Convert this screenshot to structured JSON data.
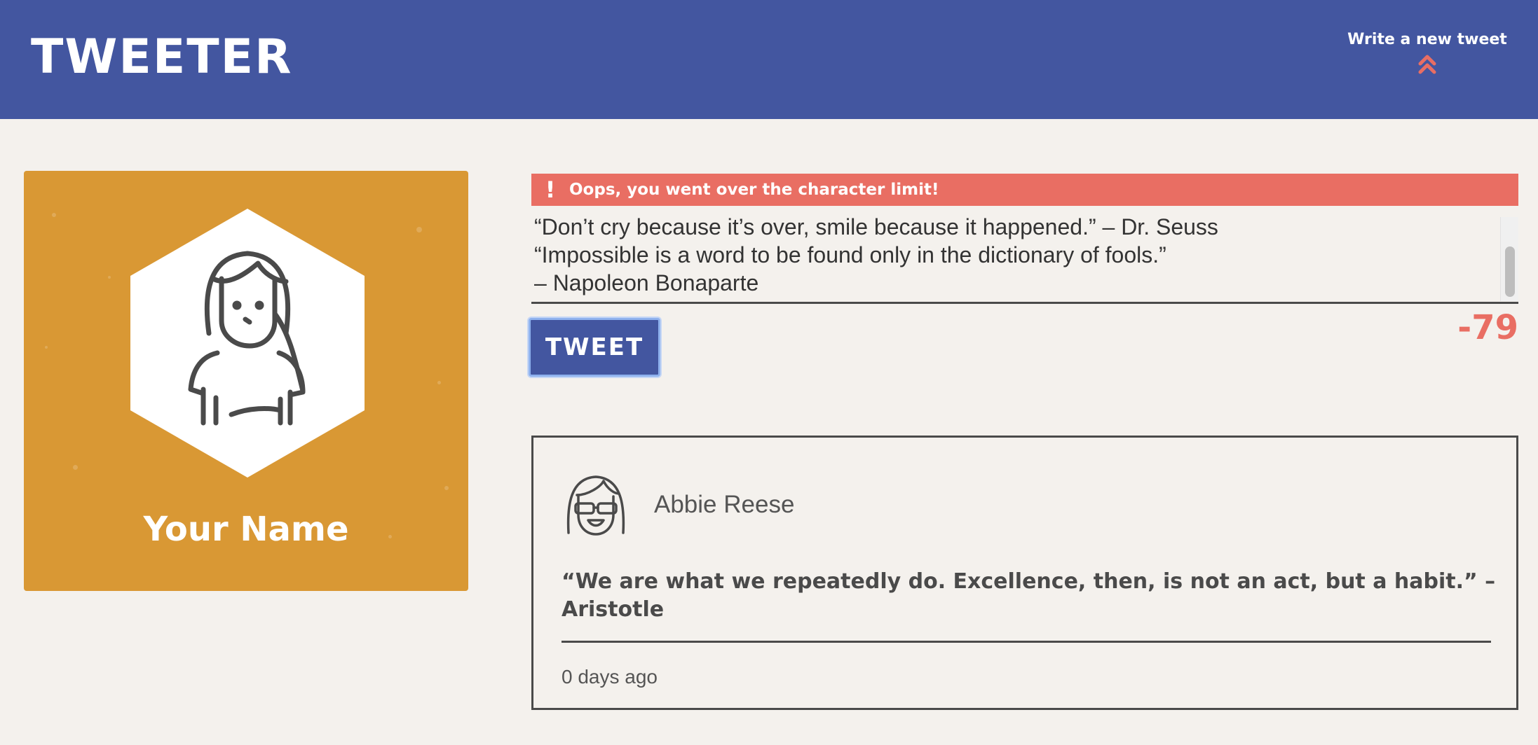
{
  "nav": {
    "brand": "TWEETER",
    "compose_label": "Write a new tweet",
    "compose_icon": "double-chevron-up-icon",
    "accent_color": "#e96e63",
    "nav_color": "#4356a0"
  },
  "profile": {
    "name": "Your Name",
    "card_color": "#d99834",
    "avatar_icon": "woman-avatar-icon"
  },
  "composer": {
    "error_icon": "exclamation-icon",
    "error_message": "Oops, you went over the character limit!",
    "text": "“Don’t cry because it’s over, smile because it happened.” – Dr. Seuss\n“Impossible is a word to be found only in the dictionary of fools.”\n– Napoleon Bonaparte",
    "submit_label": "TWEET",
    "char_counter": "-79"
  },
  "tweets": [
    {
      "author": "Abbie Reese",
      "avatar_icon": "girl-with-sunglasses-avatar-icon",
      "content": "“We are what we repeatedly do. Excellence, then, is not an act, but a habit.” – Aristotle",
      "timestamp": "0 days ago"
    }
  ]
}
